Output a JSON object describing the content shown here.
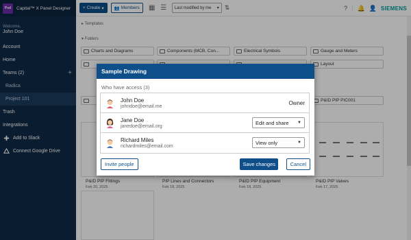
{
  "app": {
    "logo_text": "Pxd",
    "title": "Capital™ X Panel Designer"
  },
  "sidebar": {
    "welcome": "Welcome,",
    "user": "John Doe",
    "items": [
      {
        "label": "Account"
      },
      {
        "label": "Home"
      },
      {
        "label": "Teams (2)",
        "action": "+"
      },
      {
        "label": "Radica"
      },
      {
        "label": "Project 101"
      },
      {
        "label": "Trash"
      },
      {
        "label": "Integrations"
      },
      {
        "label": "Add to Slack"
      },
      {
        "label": "Connect Google Drive"
      }
    ]
  },
  "toolbar": {
    "create_label": "Create",
    "members_label": "Members",
    "sort_label": "Last modified by me",
    "brand": "SIEMENS"
  },
  "main": {
    "templates_label": "Templates",
    "folders_label": "Folders",
    "folders": [
      "Charts and Diagrams",
      "Components (MCB, Con...",
      "Electrical Symbols",
      "Gauge and Meters",
      "Layout",
      "P&ID PIP PIC001"
    ],
    "files": [
      {
        "name": "P&ID PIP Fittings",
        "date": "Feb 20, 2025"
      },
      {
        "name": "PIP Lines and Connectors",
        "date": "Feb 18, 2025"
      },
      {
        "name": "P&ID PIP Equipment",
        "date": "Feb 18, 2025"
      },
      {
        "name": "P&ID PIP Valves",
        "date": "Feb 17, 2025"
      }
    ]
  },
  "modal": {
    "title": "Sample Drawing",
    "access_label": "Who have access (3)",
    "users": [
      {
        "name": "John Doe",
        "email": "johndoe@email.me",
        "role": "Owner"
      },
      {
        "name": "Jane Doe",
        "email": "janedoe@email.org",
        "role": "Edit and share"
      },
      {
        "name": "Richard Miles",
        "email": "richardmiles@email.com",
        "role": "View only"
      }
    ],
    "invite_label": "Invite people",
    "save_label": "Save changes",
    "cancel_label": "Cancel"
  },
  "colors": {
    "primary": "#0e4f8a",
    "sidebar": "#0e2a47",
    "accent": "#009999"
  }
}
